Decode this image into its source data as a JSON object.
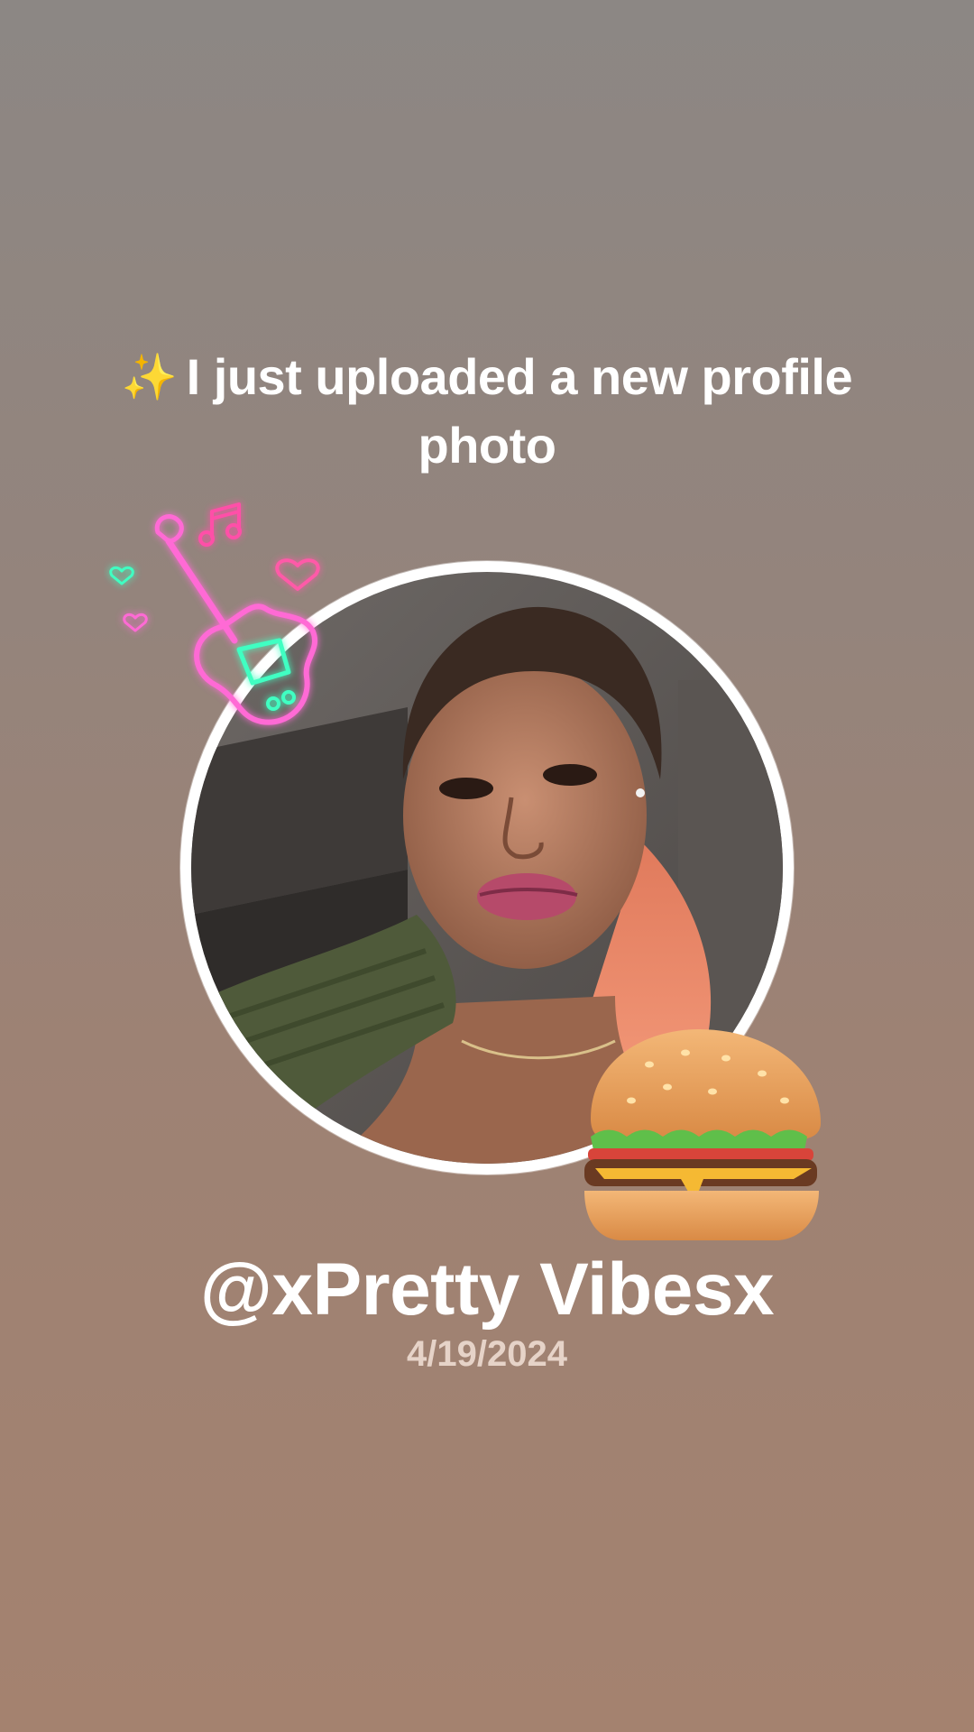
{
  "post": {
    "headline_prefix_icon": "sparkles-icon",
    "headline_text": "I just uploaded a new profile photo",
    "username": "@xPretty Vibesx",
    "date": "4/19/2024"
  },
  "stickers": [
    {
      "name": "neon-guitar-sticker",
      "icon": "guitar-music-hearts-icon"
    },
    {
      "name": "burger-sticker",
      "icon": "hamburger-icon"
    }
  ],
  "colors": {
    "background_top": "#8c8784",
    "background_bottom": "#a4826f",
    "text": "#ffffff",
    "date_text": "#e6d3c8",
    "avatar_ring": "#ffffff"
  }
}
